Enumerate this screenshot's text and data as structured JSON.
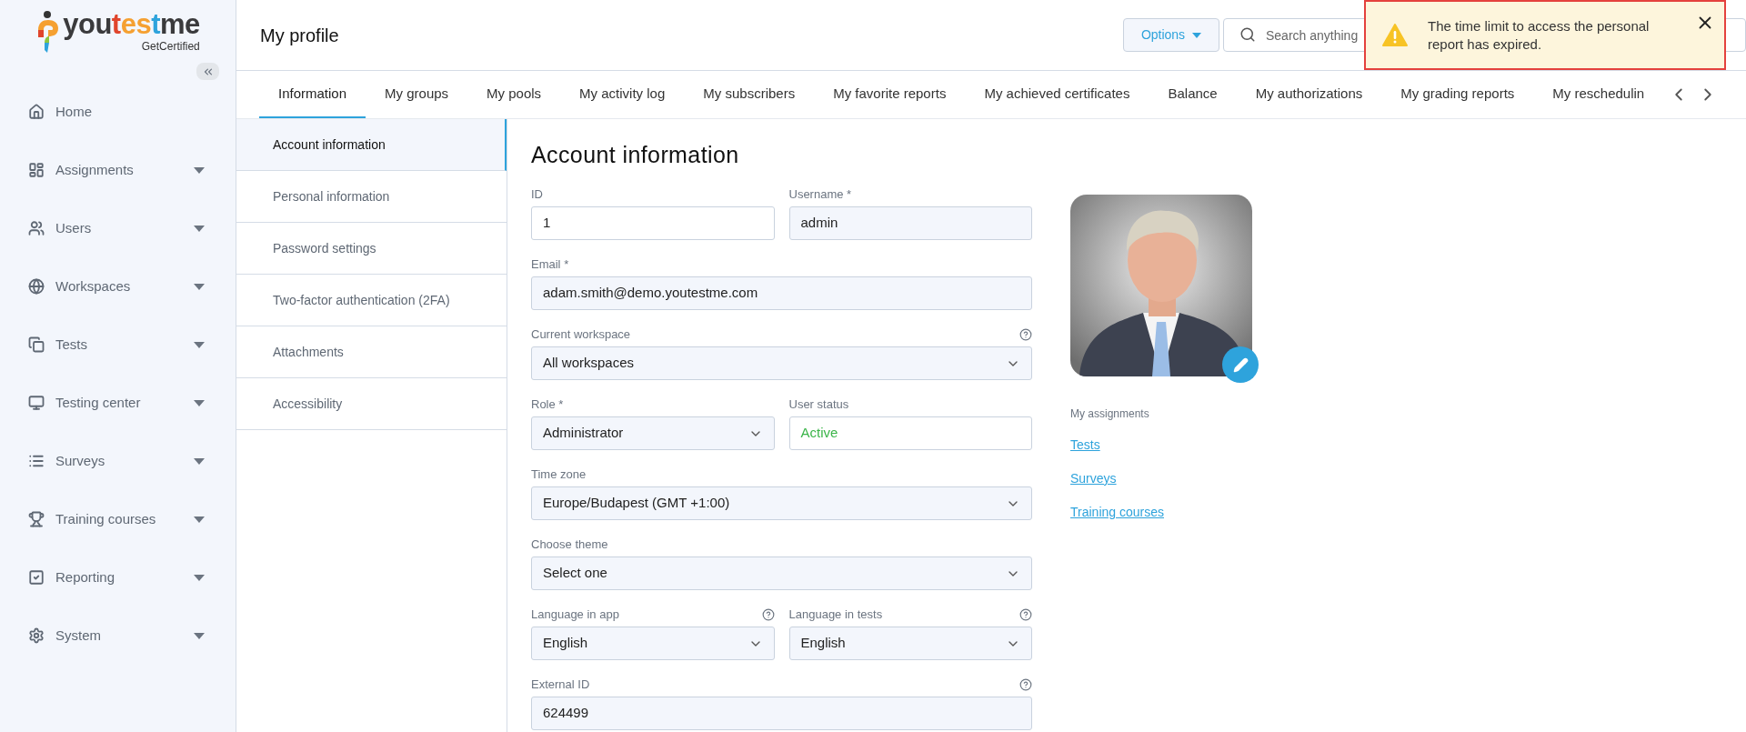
{
  "logo": {
    "parts": [
      {
        "text": "you",
        "color": "#3a3a3c"
      },
      {
        "text": "t",
        "color": "#e0452c"
      },
      {
        "text": "e",
        "color": "#f5a031"
      },
      {
        "text": "s",
        "color": "#f5a031"
      },
      {
        "text": "t",
        "color": "#2ea3dc"
      },
      {
        "text": "me",
        "color": "#3a3a3c"
      }
    ],
    "tagline": "GetCertified"
  },
  "sidebar": {
    "items": [
      {
        "label": "Home",
        "expandable": false
      },
      {
        "label": "Assignments",
        "expandable": true
      },
      {
        "label": "Users",
        "expandable": true
      },
      {
        "label": "Workspaces",
        "expandable": true
      },
      {
        "label": "Tests",
        "expandable": true
      },
      {
        "label": "Testing center",
        "expandable": true
      },
      {
        "label": "Surveys",
        "expandable": true
      },
      {
        "label": "Training courses",
        "expandable": true
      },
      {
        "label": "Reporting",
        "expandable": true
      },
      {
        "label": "System",
        "expandable": true
      }
    ]
  },
  "page_title": "My profile",
  "toolbar": {
    "options": "Options",
    "search": {
      "placeholder": "Search anything"
    }
  },
  "toast": {
    "kind": "warning",
    "message": "The time limit to access the personal report has expired."
  },
  "tabs": [
    {
      "label": "Information",
      "selected": true
    },
    {
      "label": "My groups",
      "selected": false
    },
    {
      "label": "My pools",
      "selected": false
    },
    {
      "label": "My activity log",
      "selected": false
    },
    {
      "label": "My subscribers",
      "selected": false
    },
    {
      "label": "My favorite reports",
      "selected": false
    },
    {
      "label": "My achieved certificates",
      "selected": false
    },
    {
      "label": "Balance",
      "selected": false
    },
    {
      "label": "My authorizations",
      "selected": false
    },
    {
      "label": "My grading reports",
      "selected": false
    },
    {
      "label": "My reschedulin",
      "selected": false
    }
  ],
  "subnav": [
    {
      "label": "Account information",
      "selected": true
    },
    {
      "label": "Personal information",
      "selected": false
    },
    {
      "label": "Password settings",
      "selected": false
    },
    {
      "label": "Two-factor authentication (2FA)",
      "selected": false
    },
    {
      "label": "Attachments",
      "selected": false
    },
    {
      "label": "Accessibility",
      "selected": false
    }
  ],
  "form": {
    "title": "Account information",
    "rows": [
      [
        {
          "label": "ID",
          "help": false,
          "kind": "readonly",
          "value": "1"
        },
        {
          "label": "Username",
          "required_mark": "*",
          "help": false,
          "kind": "text",
          "value": "admin"
        }
      ],
      [
        {
          "label": "Email",
          "required_mark": "*",
          "help": false,
          "kind": "text",
          "value": "adam.smith@demo.youtestme.com"
        }
      ],
      [
        {
          "label": "Current workspace",
          "help": true,
          "kind": "select",
          "value": "All workspaces"
        }
      ],
      [
        {
          "label": "Role",
          "required_mark": "*",
          "help": false,
          "kind": "select",
          "value": "Administrator"
        },
        {
          "label": "User status",
          "help": false,
          "kind": "status",
          "value": "Active"
        }
      ],
      [
        {
          "label": "Time zone",
          "help": false,
          "kind": "select",
          "value": "Europe/Budapest (GMT +1:00)"
        }
      ],
      [
        {
          "label": "Choose theme",
          "help": false,
          "kind": "select",
          "value": "Select one"
        }
      ],
      [
        {
          "label": "Language in app",
          "help": true,
          "kind": "select",
          "value": "English"
        },
        {
          "label": "Language in tests",
          "help": true,
          "kind": "select",
          "value": "English"
        }
      ],
      [
        {
          "label": "External ID",
          "help": true,
          "kind": "text",
          "value": "624499"
        }
      ]
    ]
  },
  "assignments": {
    "title": "My assignments",
    "links": [
      "Tests",
      "Surveys",
      "Training courses"
    ]
  }
}
